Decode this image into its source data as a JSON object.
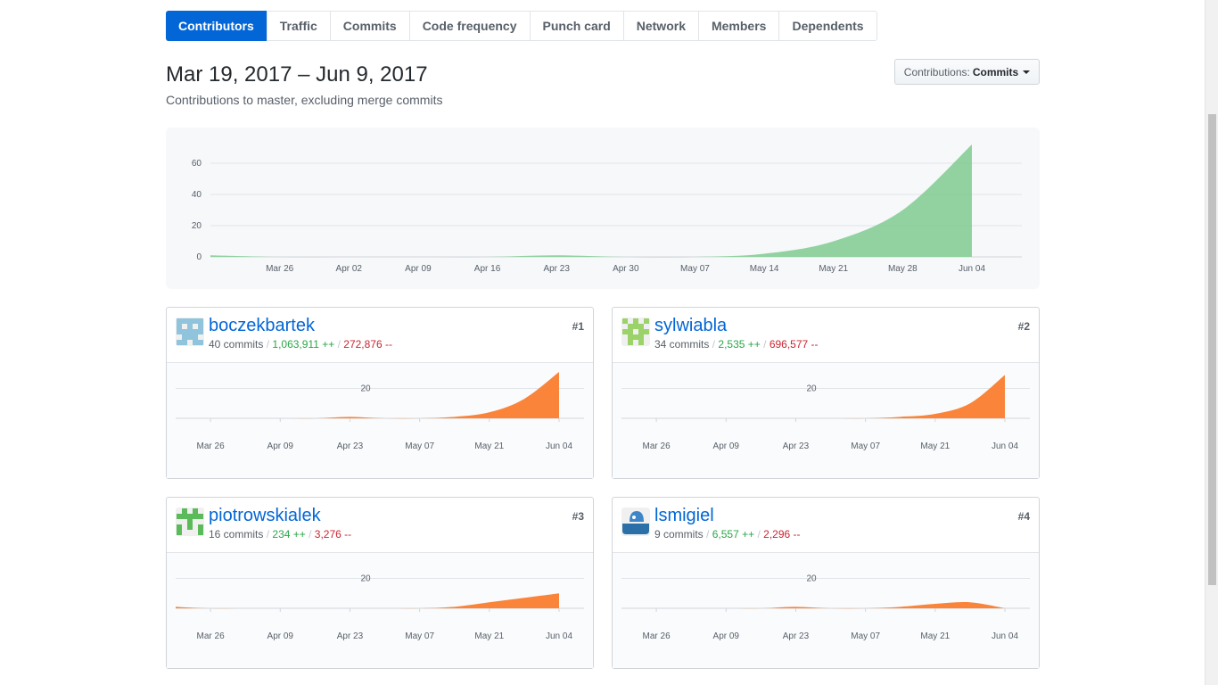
{
  "tabs": [
    {
      "label": "Contributors",
      "selected": true
    },
    {
      "label": "Traffic",
      "selected": false
    },
    {
      "label": "Commits",
      "selected": false
    },
    {
      "label": "Code frequency",
      "selected": false
    },
    {
      "label": "Punch card",
      "selected": false
    },
    {
      "label": "Network",
      "selected": false
    },
    {
      "label": "Members",
      "selected": false
    },
    {
      "label": "Dependents",
      "selected": false
    }
  ],
  "header": {
    "title": "Mar 19, 2017 – Jun 9, 2017",
    "subtitle": "Contributions to master, excluding merge commits"
  },
  "contributions_select": {
    "label": "Contributions:",
    "value": "Commits"
  },
  "colors": {
    "accent": "#0366d6",
    "main_area": "#7fcb8f",
    "card_area": "#f9843a",
    "additions": "#28a745",
    "deletions": "#cb2431"
  },
  "chart_data": [
    {
      "type": "area",
      "x": [
        "Mar 19",
        "Mar 26",
        "Apr 02",
        "Apr 09",
        "Apr 16",
        "Apr 23",
        "Apr 30",
        "May 07",
        "May 14",
        "May 21",
        "May 28",
        "Jun 04"
      ],
      "x_tick_labels": [
        "Mar 26",
        "Apr 02",
        "Apr 09",
        "Apr 16",
        "Apr 23",
        "Apr 30",
        "May 07",
        "May 14",
        "May 21",
        "May 28",
        "Jun 04"
      ],
      "y_tick_labels": [
        "0",
        "20",
        "40",
        "60"
      ],
      "values": [
        1,
        0,
        0,
        0,
        0,
        1,
        0,
        0,
        2,
        10,
        30,
        72
      ],
      "ylim": [
        0,
        72
      ],
      "grid": true
    },
    {
      "type": "area",
      "x": [
        "Mar 19",
        "Mar 26",
        "Apr 02",
        "Apr 09",
        "Apr 16",
        "Apr 23",
        "Apr 30",
        "May 07",
        "May 14",
        "May 21",
        "May 28",
        "Jun 04"
      ],
      "x_tick_labels": [
        "Mar 26",
        "Apr 09",
        "Apr 23",
        "May 07",
        "May 21",
        "Jun 04"
      ],
      "y_tick_labels": [
        "20"
      ],
      "values": [
        0,
        0,
        0,
        0,
        0,
        1,
        0,
        0,
        1,
        4,
        13,
        31
      ],
      "ylim": [
        0,
        31
      ],
      "grid": true
    },
    {
      "type": "area",
      "x": [
        "Mar 19",
        "Mar 26",
        "Apr 02",
        "Apr 09",
        "Apr 16",
        "Apr 23",
        "Apr 30",
        "May 07",
        "May 14",
        "May 21",
        "May 28",
        "Jun 04"
      ],
      "x_tick_labels": [
        "Mar 26",
        "Apr 09",
        "Apr 23",
        "May 07",
        "May 21",
        "Jun 04"
      ],
      "y_tick_labels": [
        "20"
      ],
      "values": [
        0,
        0,
        0,
        0,
        0,
        0,
        0,
        0,
        1,
        3,
        10,
        29
      ],
      "ylim": [
        0,
        31
      ],
      "grid": true
    },
    {
      "type": "area",
      "x": [
        "Mar 19",
        "Mar 26",
        "Apr 02",
        "Apr 09",
        "Apr 16",
        "Apr 23",
        "Apr 30",
        "May 07",
        "May 14",
        "May 21",
        "May 28",
        "Jun 04"
      ],
      "x_tick_labels": [
        "Mar 26",
        "Apr 09",
        "Apr 23",
        "May 07",
        "May 21",
        "Jun 04"
      ],
      "y_tick_labels": [
        "20"
      ],
      "values": [
        1,
        0,
        0,
        0,
        0,
        0,
        0,
        0,
        1,
        4,
        7,
        10
      ],
      "ylim": [
        0,
        31
      ],
      "grid": true
    },
    {
      "type": "area",
      "x": [
        "Mar 19",
        "Mar 26",
        "Apr 02",
        "Apr 09",
        "Apr 16",
        "Apr 23",
        "Apr 30",
        "May 07",
        "May 14",
        "May 21",
        "May 28",
        "Jun 04"
      ],
      "x_tick_labels": [
        "Mar 26",
        "Apr 09",
        "Apr 23",
        "May 07",
        "May 21",
        "Jun 04"
      ],
      "y_tick_labels": [
        "20"
      ],
      "values": [
        0,
        0,
        0,
        0,
        0,
        1,
        0,
        0,
        1,
        3,
        4,
        0
      ],
      "ylim": [
        0,
        31
      ],
      "grid": true
    }
  ],
  "contributors": [
    {
      "name": "boczekbartek",
      "commits": "40 commits",
      "additions": "1,063,911 ++",
      "deletions": "272,876 --",
      "rank": "#1",
      "avatar": "identicon-blue-icon"
    },
    {
      "name": "sylwiabla",
      "commits": "34 commits",
      "additions": "2,535 ++",
      "deletions": "696,577 --",
      "rank": "#2",
      "avatar": "identicon-lime-icon"
    },
    {
      "name": "piotrowskialek",
      "commits": "16 commits",
      "additions": "234 ++",
      "deletions": "3,276 --",
      "rank": "#3",
      "avatar": "identicon-green-icon"
    },
    {
      "name": "lsmigiel",
      "commits": "9 commits",
      "additions": "6,557 ++",
      "deletions": "2,296 --",
      "rank": "#4",
      "avatar": "docker-whale-icon"
    }
  ],
  "separator": "/"
}
